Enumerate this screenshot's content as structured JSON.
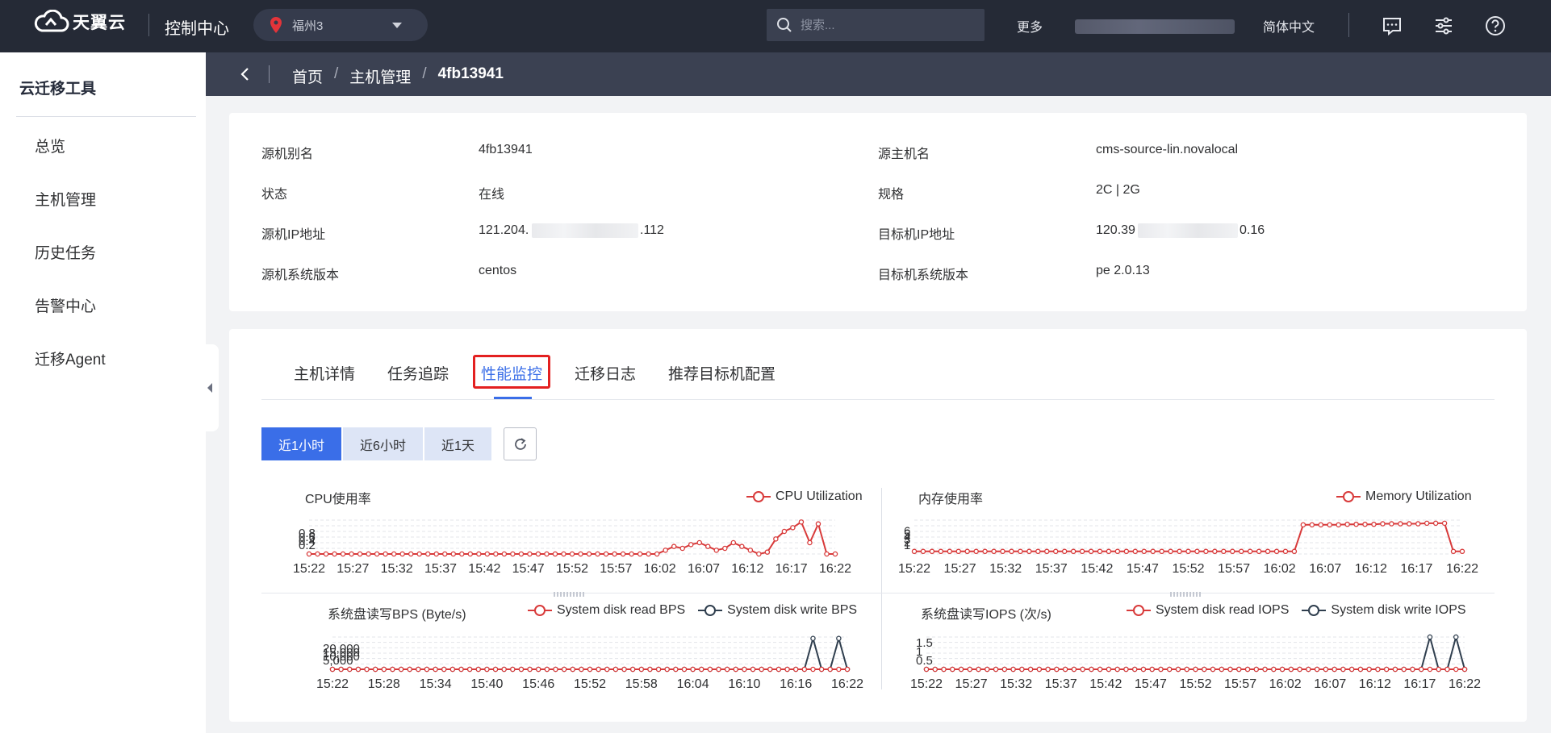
{
  "topbar": {
    "logo_text": "天翼云",
    "console": "控制中心",
    "region": "福州3",
    "search_placeholder": "搜索...",
    "more": "更多",
    "language": "简体中文",
    "icons": [
      "message-icon",
      "settings-sliders-icon",
      "help-icon"
    ]
  },
  "sidebar": {
    "title": "云迁移工具",
    "items": [
      {
        "label": "总览"
      },
      {
        "label": "主机管理"
      },
      {
        "label": "历史任务"
      },
      {
        "label": "告警中心"
      },
      {
        "label": "迁移Agent"
      }
    ]
  },
  "breadcrumb": {
    "items": [
      "首页",
      "主机管理",
      "4fb13941"
    ]
  },
  "info": {
    "source_alias_label": "源机别名",
    "source_alias": "4fb13941",
    "source_host_label": "源主机名",
    "source_host": "cms-source-lin.novalocal",
    "status_label": "状态",
    "status": "在线",
    "spec_label": "规格",
    "spec": "2C | 2G",
    "source_ip_label": "源机IP地址",
    "source_ip_prefix": "121.204.",
    "source_ip_suffix": ".112",
    "target_ip_label": "目标机IP地址",
    "target_ip_prefix": "120.39",
    "target_ip_suffix": "0.16",
    "source_os_label": "源机系统版本",
    "source_os": "centos",
    "target_os_label": "目标机系统版本",
    "target_os": "pe 2.0.13"
  },
  "tabs": [
    "主机详情",
    "任务追踪",
    "性能监控",
    "迁移日志",
    "推荐目标机配置"
  ],
  "active_tab": "性能监控",
  "time_buttons": [
    "近1小时",
    "近6小时",
    "近1天"
  ],
  "active_time": "近1小时",
  "colors": {
    "accent": "#3a6ee8",
    "read": "#d83a3a",
    "write": "#2f3e4e",
    "highlight": "#e32020"
  },
  "chart_data": [
    {
      "type": "line",
      "title": "CPU使用率",
      "series": [
        {
          "name": "CPU Utilization",
          "color": "#d83a3a",
          "values": [
            0,
            0,
            0,
            0,
            0,
            0,
            0,
            0,
            0,
            0,
            0,
            0,
            0,
            0,
            0,
            0,
            0,
            0,
            0,
            0,
            0,
            0,
            0,
            0,
            0,
            0,
            0,
            0,
            0,
            0,
            0,
            0,
            0,
            0,
            0,
            0,
            0,
            0,
            0,
            0,
            0,
            0,
            0.1,
            0.2,
            0.15,
            0.25,
            0.3,
            0.2,
            0.1,
            0.15,
            0.3,
            0.2,
            0.1,
            0,
            0.05,
            0.4,
            0.6,
            0.7,
            0.85,
            0.3,
            0.8,
            0,
            0
          ]
        }
      ],
      "x_ticks": [
        "15:22",
        "15:27",
        "15:32",
        "15:37",
        "15:42",
        "15:47",
        "15:52",
        "15:57",
        "16:02",
        "16:07",
        "16:12",
        "16:17",
        "16:22"
      ],
      "y_ticks": [
        "0.2",
        "0.4",
        "0.6",
        "0.8"
      ],
      "ylim": [
        0,
        0.9
      ]
    },
    {
      "type": "line",
      "title": "内存使用率",
      "series": [
        {
          "name": "Memory Utilization",
          "color": "#d83a3a",
          "values": [
            0.5,
            0.5,
            0.5,
            0.5,
            0.5,
            0.5,
            0.5,
            0.5,
            0.5,
            0.5,
            0.5,
            0.5,
            0.5,
            0.5,
            0.5,
            0.5,
            0.5,
            0.5,
            0.5,
            0.5,
            0.5,
            0.5,
            0.5,
            0.5,
            0.5,
            0.5,
            0.5,
            0.5,
            0.5,
            0.5,
            0.5,
            0.5,
            0.5,
            0.5,
            0.5,
            0.5,
            0.5,
            0.5,
            0.5,
            0.5,
            0.5,
            0.5,
            0.5,
            0.5,
            5.6,
            5.6,
            5.6,
            5.6,
            5.6,
            5.7,
            5.7,
            5.7,
            5.7,
            5.8,
            5.8,
            5.8,
            5.8,
            5.8,
            5.9,
            5.9,
            5.9,
            0.5,
            0.5
          ]
        }
      ],
      "x_ticks": [
        "15:22",
        "15:27",
        "15:32",
        "15:37",
        "15:42",
        "15:47",
        "15:52",
        "15:57",
        "16:02",
        "16:07",
        "16:12",
        "16:17",
        "16:22"
      ],
      "y_ticks": [
        "1",
        "2",
        "3",
        "4",
        "5",
        "6"
      ],
      "ylim": [
        0,
        6.5
      ]
    },
    {
      "type": "line",
      "title": "系统盘读写BPS (Byte/s)",
      "series": [
        {
          "name": "System disk read BPS",
          "color": "#d83a3a",
          "values": [
            0,
            0,
            0,
            0,
            0,
            0,
            0,
            0,
            0,
            0,
            0,
            0,
            0,
            0,
            0,
            0,
            0,
            0,
            0,
            0,
            0,
            0,
            0,
            0,
            0,
            0,
            0,
            0,
            0,
            0,
            0,
            0,
            0,
            0,
            0,
            0,
            0,
            0,
            0,
            0,
            0,
            0,
            0,
            0,
            0,
            0,
            0,
            0,
            0,
            0,
            0,
            0,
            0,
            0,
            0,
            0,
            0,
            0,
            0,
            0,
            0
          ]
        },
        {
          "name": "System disk write BPS",
          "color": "#2f3e4e",
          "values": [
            0,
            0,
            0,
            0,
            0,
            0,
            0,
            0,
            0,
            0,
            0,
            0,
            0,
            0,
            0,
            0,
            0,
            0,
            0,
            0,
            0,
            0,
            0,
            0,
            0,
            0,
            0,
            0,
            0,
            0,
            0,
            0,
            0,
            0,
            0,
            0,
            0,
            0,
            0,
            0,
            0,
            0,
            0,
            0,
            0,
            0,
            0,
            0,
            0,
            0,
            0,
            0,
            0,
            0,
            0,
            0,
            22000,
            0,
            0,
            22000,
            0
          ]
        }
      ],
      "x_ticks": [
        "15:22",
        "15:28",
        "15:34",
        "15:40",
        "15:46",
        "15:52",
        "15:58",
        "16:04",
        "16:10",
        "16:16",
        "16:22"
      ],
      "y_ticks": [
        "5,000",
        "10,000",
        "15,000",
        "20,000"
      ],
      "ylim": [
        0,
        23000
      ]
    },
    {
      "type": "line",
      "title": "系统盘读写IOPS (次/s)",
      "series": [
        {
          "name": "System disk read IOPS",
          "color": "#d83a3a",
          "values": [
            0,
            0,
            0,
            0,
            0,
            0,
            0,
            0,
            0,
            0,
            0,
            0,
            0,
            0,
            0,
            0,
            0,
            0,
            0,
            0,
            0,
            0,
            0,
            0,
            0,
            0,
            0,
            0,
            0,
            0,
            0,
            0,
            0,
            0,
            0,
            0,
            0,
            0,
            0,
            0,
            0,
            0,
            0,
            0,
            0,
            0,
            0,
            0,
            0,
            0,
            0,
            0,
            0,
            0,
            0,
            0,
            0,
            0,
            0,
            0,
            0,
            0,
            0
          ]
        },
        {
          "name": "System disk  write IOPS",
          "color": "#2f3e4e",
          "values": [
            0,
            0,
            0,
            0,
            0,
            0,
            0,
            0,
            0,
            0,
            0,
            0,
            0,
            0,
            0,
            0,
            0,
            0,
            0,
            0,
            0,
            0,
            0,
            0,
            0,
            0,
            0,
            0,
            0,
            0,
            0,
            0,
            0,
            0,
            0,
            0,
            0,
            0,
            0,
            0,
            0,
            0,
            0,
            0,
            0,
            0,
            0,
            0,
            0,
            0,
            0,
            0,
            0,
            0,
            0,
            0,
            0,
            0,
            2,
            0,
            0,
            2,
            0
          ]
        }
      ],
      "x_ticks": [
        "15:22",
        "15:27",
        "15:32",
        "15:37",
        "15:42",
        "15:47",
        "15:52",
        "15:57",
        "16:02",
        "16:07",
        "16:12",
        "16:17",
        "16:22"
      ],
      "y_ticks": [
        "0.5",
        "1",
        "1.5"
      ],
      "ylim": [
        0,
        2
      ]
    }
  ]
}
